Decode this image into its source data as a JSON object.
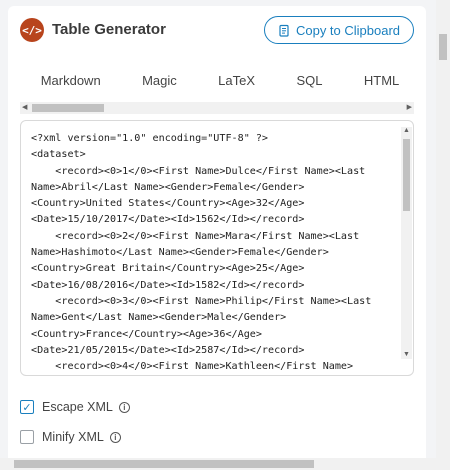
{
  "header": {
    "title": "Table Generator",
    "copy_label": "Copy to Clipboard",
    "logo_glyph": "</>",
    "accent": "#1a7fbe",
    "logo_color": "#b8441c"
  },
  "tabs": [
    {
      "label": "Markdown"
    },
    {
      "label": "Magic"
    },
    {
      "label": "LaTeX"
    },
    {
      "label": "SQL"
    },
    {
      "label": "HTML"
    }
  ],
  "code": {
    "lines": [
      "<?xml version=\"1.0\" encoding=\"UTF-8\" ?>",
      "<dataset>",
      "    <record><0>1</0><First Name>Dulce</First Name><Last",
      "Name>Abril</Last Name><Gender>Female</Gender>",
      "<Country>United States</Country><Age>32</Age>",
      "<Date>15/10/2017</Date><Id>1562</Id></record>",
      "    <record><0>2</0><First Name>Mara</First Name><Last",
      "Name>Hashimoto</Last Name><Gender>Female</Gender>",
      "<Country>Great Britain</Country><Age>25</Age>",
      "<Date>16/08/2016</Date><Id>1582</Id></record>",
      "    <record><0>3</0><First Name>Philip</First Name><Last",
      "Name>Gent</Last Name><Gender>Male</Gender>",
      "<Country>France</Country><Age>36</Age>",
      "<Date>21/05/2015</Date><Id>2587</Id></record>",
      "    <record><0>4</0><First Name>Kathleen</First Name>"
    ]
  },
  "options": {
    "escape_xml": {
      "label": "Escape XML",
      "checked": true
    },
    "minify_xml": {
      "label": "Minify XML",
      "checked": false
    }
  }
}
